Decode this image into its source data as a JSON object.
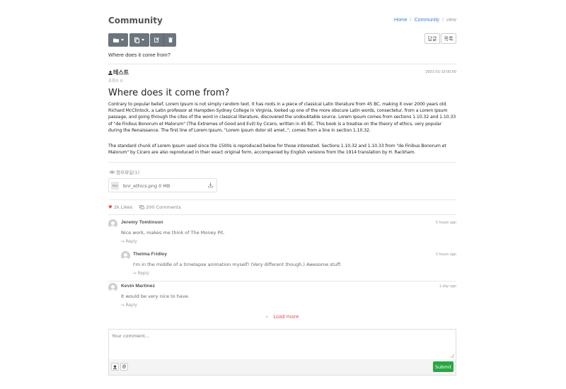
{
  "header": {
    "title": "Community",
    "breadcrumb": {
      "home": "Home",
      "section": "Community",
      "current": "view"
    }
  },
  "toolbar": {
    "buttons": [
      "folder-dropdown",
      "copy-dropdown",
      "edit",
      "delete"
    ],
    "reply_label": "답글",
    "list_label": "목록"
  },
  "post": {
    "subject": "Where does it come from?",
    "author": "테스트",
    "views": "조회수 0",
    "date": "2021-01-19 00:00",
    "title": "Where does it come from?",
    "paragraphs": [
      "Contrary to popular belief, Lorem Ipsum is not simply random text. It has roots in a piece of classical Latin literature from 45 BC, making it over 2000 years old. Richard McClintock, a Latin professor at Hampden-Sydney College in Virginia, looked up one of the more obscure Latin words, consectetur, from a Lorem Ipsum passage, and going through the cites of the word in classical literature, discovered the undoubtable source. Lorem Ipsum comes from sections 1.10.32 and 1.10.33 of \"de Finibus Bonorum et Malorum\" (The Extremes of Good and Evil) by Cicero, written in 45 BC. This book is a treatise on the theory of ethics, very popular during the Renaissance. The first line of Lorem Ipsum, \"Lorem ipsum dolor sit amet..\", comes from a line in section 1.10.32.",
      "The standard chunk of Lorem Ipsum used since the 1500s is reproduced below for those interested. Sections 1.10.32 and 1.10.33 from \"de Finibus Bonorum et Malorum\" by Cicero are also reproduced in their exact original form, accompanied by English versions from the 1914 translation by H. Rackham."
    ]
  },
  "attachments": {
    "label": "첨부파일(1)",
    "file": {
      "type": "PNG",
      "name": "bnr_ethics.png 0 MB"
    }
  },
  "stats": {
    "likes": "2k Likes",
    "comments": "200 Comments"
  },
  "comments": [
    {
      "name": "Jeremy Tomlinson",
      "time": "5 hours ago",
      "text": "Nice work, makes me think of The Money Pit.",
      "reply": "Reply"
    },
    {
      "name": "Thelma Fridley",
      "time": "5 hours ago",
      "text": "I'm in the middle of a timelapse animation myself! (Very different though.) Awesome stuff.",
      "reply": "Reply"
    },
    {
      "name": "Kevin Martinez",
      "time": "1 day ago",
      "text": "It would be very nice to have.",
      "reply": "Reply"
    }
  ],
  "load_more": "Load more",
  "comment_form": {
    "placeholder": "Your comment...",
    "attach_icon": "upload-icon",
    "mention_label": "@",
    "submit_label": "Submit"
  },
  "colors": {
    "accent_link": "#3b7fd4",
    "danger": "#d9534f",
    "success": "#28a745",
    "toolbar_bg": "#6c757d"
  }
}
